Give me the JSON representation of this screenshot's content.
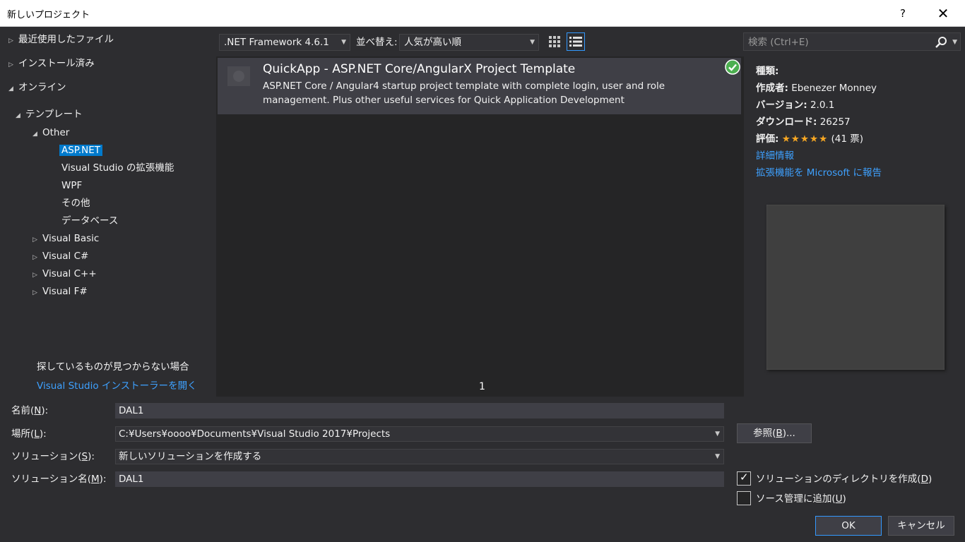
{
  "window": {
    "title": "新しいプロジェクト",
    "help": "?",
    "close": "✕"
  },
  "tree": {
    "recent": "最近使用したファイル",
    "installed": "インストール済み",
    "online": "オンライン",
    "templates": "テンプレート",
    "other": "Other",
    "other_children": [
      "ASP.NET",
      "Visual Studio の拡張機能",
      "WPF",
      "その他",
      "データベース"
    ],
    "languages": [
      "Visual Basic",
      "Visual C#",
      "Visual C++",
      "Visual F#"
    ]
  },
  "hint": {
    "text": "探しているものが見つからない場合",
    "link": "Visual Studio インストーラーを開く"
  },
  "toolbar": {
    "framework": ".NET Framework 4.6.1",
    "sort_label": "並べ替え:",
    "sort_value": "人気が高い順",
    "search_placeholder": "検索 (Ctrl+E)"
  },
  "templates": [
    {
      "name": "QuickApp - ASP.NET Core/AngularX Project Template",
      "description": "ASP.NET Core / Angular4 startup project template with complete login, user and role management. Plus other useful services for Quick Application Development"
    }
  ],
  "pager": {
    "page": "1"
  },
  "details": {
    "type_label": "種類:",
    "type_value": "",
    "author_label": "作成者:",
    "author_value": "Ebenezer Monney",
    "version_label": "バージョン:",
    "version_value": "2.0.1",
    "downloads_label": "ダウンロード:",
    "downloads_value": "26257",
    "rating_label": "評価:",
    "rating_stars": "★★★★★",
    "rating_count": "(41 票)",
    "more_info": "詳細情報",
    "report": "拡張機能を Microsoft に報告"
  },
  "form": {
    "name_label": "名前",
    "name_key": "N",
    "name_value": "DAL1",
    "location_label": "場所",
    "location_key": "L",
    "location_value": "C:¥Users¥oooo¥Documents¥Visual Studio 2017¥Projects",
    "solution_label": "ソリューション",
    "solution_key": "S",
    "solution_value": "新しいソリューションを作成する",
    "solution_name_label": "ソリューション名",
    "solution_name_key": "M",
    "solution_name_value": "DAL1",
    "browse_label": "参照",
    "browse_key": "B",
    "browse_suffix": "...",
    "create_dir_label": "ソリューションのディレクトリを作成",
    "create_dir_key": "D",
    "source_control_label": "ソース管理に追加",
    "source_control_key": "U",
    "ok": "OK",
    "cancel": "キャンセル"
  },
  "colors": {
    "accent": "#007acc",
    "link": "#3ea1ff",
    "star": "#f5a623",
    "check": "#4caf50"
  }
}
